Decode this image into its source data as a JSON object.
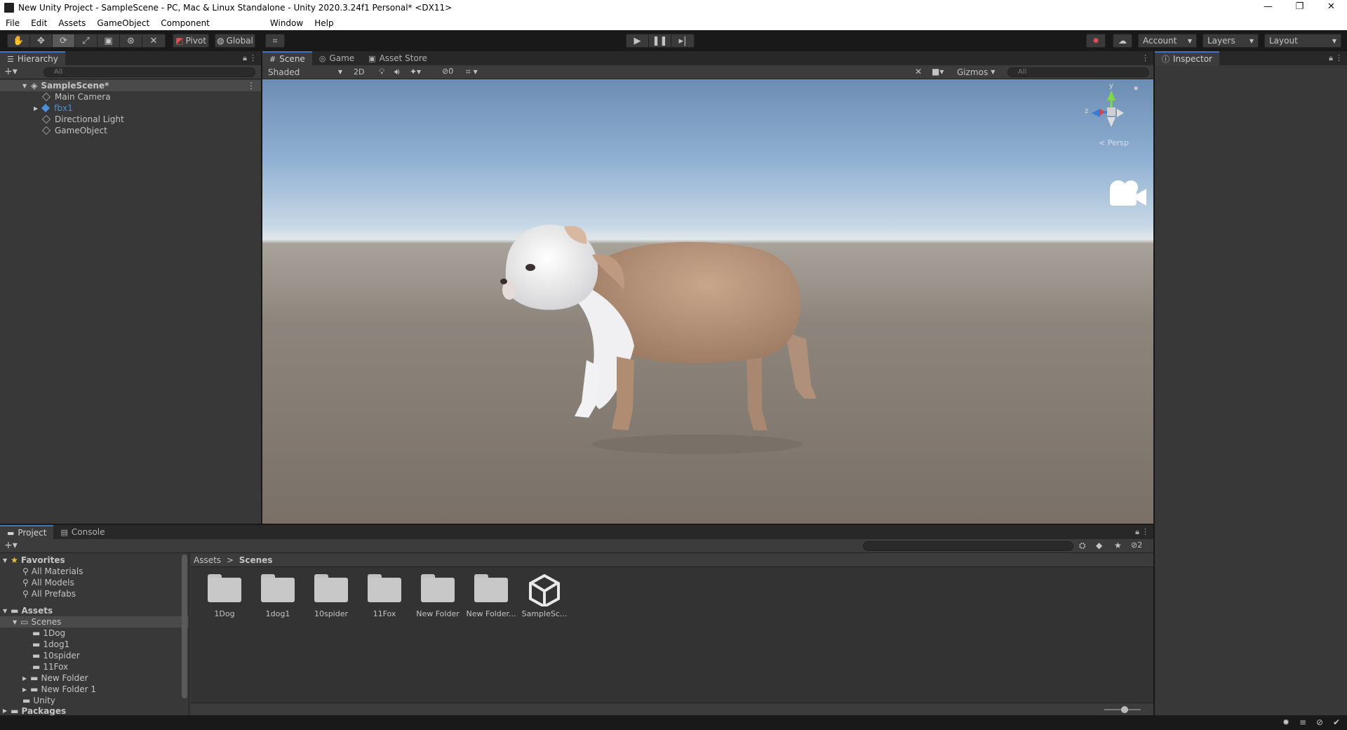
{
  "window": {
    "title": "New Unity Project - SampleScene - PC, Mac & Linux Standalone - Unity 2020.3.24f1 Personal* <DX11>",
    "controls": [
      "—",
      "❐",
      "✕"
    ]
  },
  "menu": [
    "File",
    "Edit",
    "Assets",
    "GameObject",
    "Component",
    "Window",
    "Help"
  ],
  "toolbar": {
    "pivot": "Pivot",
    "global": "Global",
    "account": "Account",
    "layers": "Layers",
    "layout": "Layout"
  },
  "hierarchy": {
    "tab": "Hierarchy",
    "search_placeholder": "All",
    "scene": "SampleScene*",
    "items": [
      {
        "label": "Main Camera"
      },
      {
        "label": "fbx1"
      },
      {
        "label": "Directional Light"
      },
      {
        "label": "GameObject"
      }
    ]
  },
  "scene_tabs": [
    "Scene",
    "Game",
    "Asset Store"
  ],
  "scene_toolbar": {
    "shading": "Shaded",
    "mode_2d": "2D",
    "hidden_count": "0",
    "gizmos": "Gizmos",
    "search_placeholder": "All"
  },
  "gizmo": {
    "axis_y": "y",
    "axis_z": "z",
    "projection": "< Persp"
  },
  "inspector": {
    "tab": "Inspector"
  },
  "project": {
    "tabs": [
      "Project",
      "Console"
    ],
    "hidden_count": "2",
    "favorites": {
      "label": "Favorites",
      "items": [
        "All Materials",
        "All Models",
        "All Prefabs"
      ]
    },
    "assets": {
      "label": "Assets",
      "scenes": "Scenes",
      "scene_children": [
        "1Dog",
        "1dog1",
        "10spider",
        "11Fox",
        "New Folder",
        "New Folder 1"
      ],
      "unity": "Unity",
      "packages": "Packages"
    },
    "breadcrumb": {
      "root": "Assets",
      "sep": ">",
      "current": "Scenes"
    },
    "grid_items": [
      {
        "label": "1Dog",
        "kind": "folder"
      },
      {
        "label": "1dog1",
        "kind": "folder"
      },
      {
        "label": "10spider",
        "kind": "folder"
      },
      {
        "label": "11Fox",
        "kind": "folder"
      },
      {
        "label": "New Folder",
        "kind": "folder"
      },
      {
        "label": "New Folder...",
        "kind": "folder"
      },
      {
        "label": "SampleSc...",
        "kind": "unity-scene"
      }
    ]
  },
  "colors": {
    "accent": "#3a79bb",
    "panel_bg": "#383838",
    "selected_text": "#4d8fd6"
  }
}
